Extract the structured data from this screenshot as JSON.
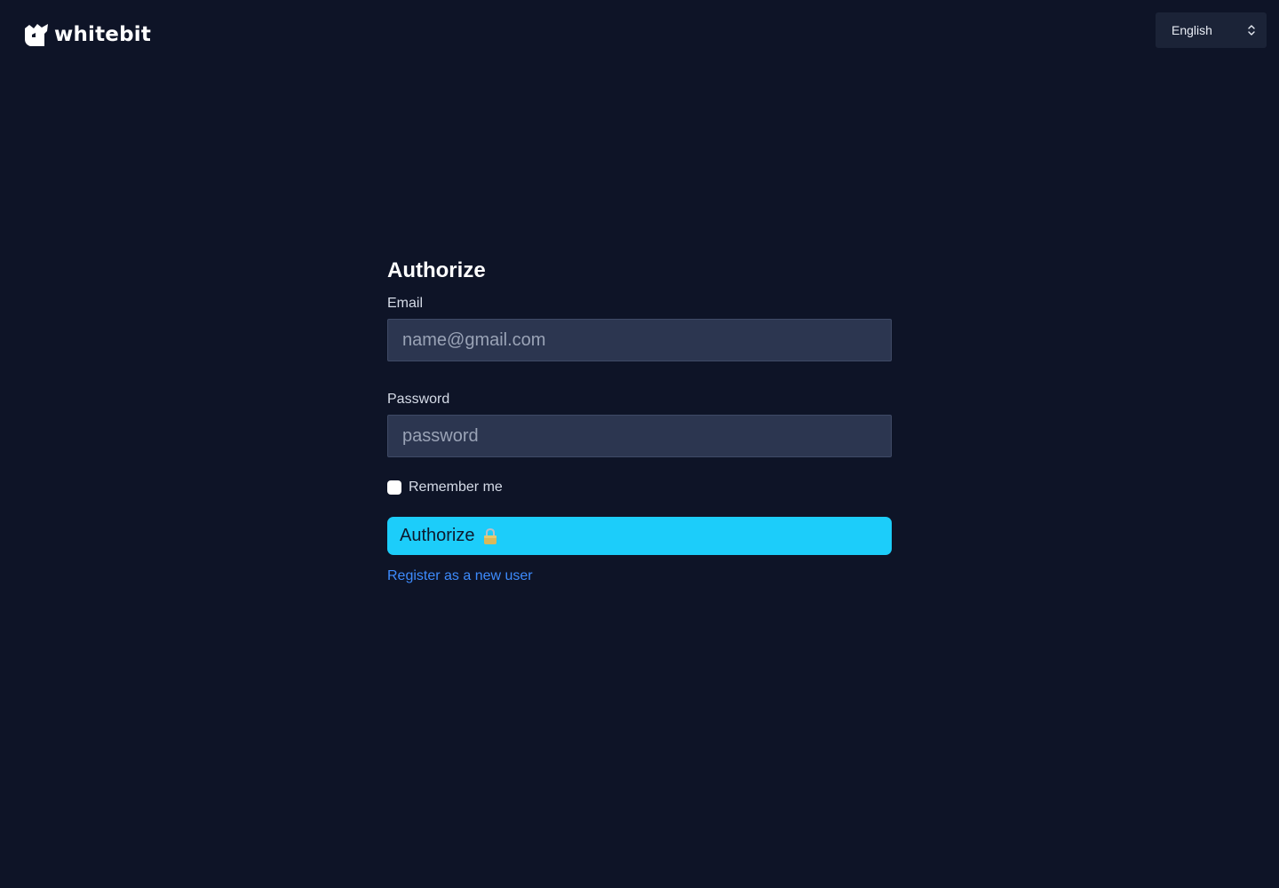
{
  "header": {
    "brand": "whitebit",
    "language": {
      "selected": "English"
    }
  },
  "form": {
    "title": "Authorize",
    "email": {
      "label": "Email",
      "value": "",
      "placeholder": "name@gmail.com"
    },
    "password": {
      "label": "Password",
      "value": "",
      "placeholder": "password"
    },
    "remember": {
      "label": "Remember me",
      "checked": false
    },
    "submit": {
      "label": "Authorize",
      "icon": "lock-icon"
    },
    "register_link": "Register as a new user"
  },
  "colors": {
    "background": "#0e1427",
    "input_background": "#2c3650",
    "accent": "#1ccdfa",
    "link": "#3d8bfd"
  }
}
